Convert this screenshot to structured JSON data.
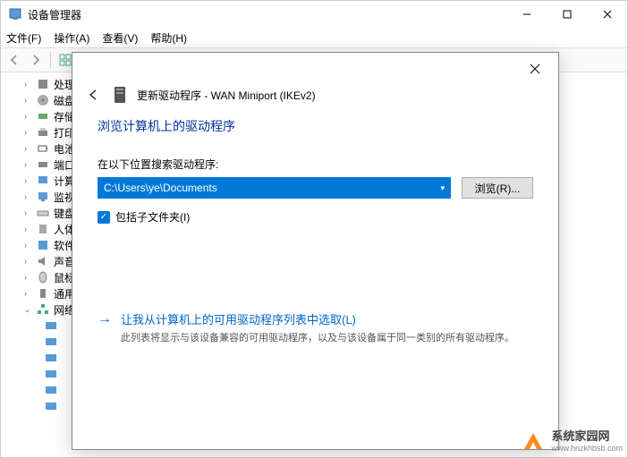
{
  "window": {
    "title": "设备管理器"
  },
  "menu": {
    "file": "文件(F)",
    "action": "操作(A)",
    "view": "查看(V)",
    "help": "帮助(H)"
  },
  "tree": {
    "items": [
      {
        "icon": "cpu",
        "label": "处理"
      },
      {
        "icon": "disk",
        "label": "磁盘"
      },
      {
        "icon": "storage",
        "label": "存储"
      },
      {
        "icon": "printer",
        "label": "打印"
      },
      {
        "icon": "battery",
        "label": "电池"
      },
      {
        "icon": "port",
        "label": "端口"
      },
      {
        "icon": "computer",
        "label": "计算"
      },
      {
        "icon": "monitor",
        "label": "监视"
      },
      {
        "icon": "keyboard",
        "label": "键盘"
      },
      {
        "icon": "hid",
        "label": "人体"
      },
      {
        "icon": "software",
        "label": "软件"
      },
      {
        "icon": "sound",
        "label": "声音"
      },
      {
        "icon": "mouse",
        "label": "鼠标"
      },
      {
        "icon": "usb",
        "label": "通用"
      },
      {
        "icon": "network",
        "label": "网络"
      }
    ]
  },
  "dialog": {
    "title": "更新驱动程序 - WAN Miniport (IKEv2)",
    "heading": "浏览计算机上的驱动程序",
    "search_label": "在以下位置搜索驱动程序:",
    "path_value": "C:\\Users\\ye\\Documents",
    "browse_button": "浏览(R)...",
    "include_subfolders": "包括子文件夹(I)",
    "pick_title": "让我从计算机上的可用驱动程序列表中选取(L)",
    "pick_desc": "此列表将显示与该设备兼容的可用驱动程序，以及与该设备属于同一类别的所有驱动程序。"
  },
  "watermark": {
    "line1": "系统家园网",
    "line2": "www.hnzkhbsb.com"
  }
}
